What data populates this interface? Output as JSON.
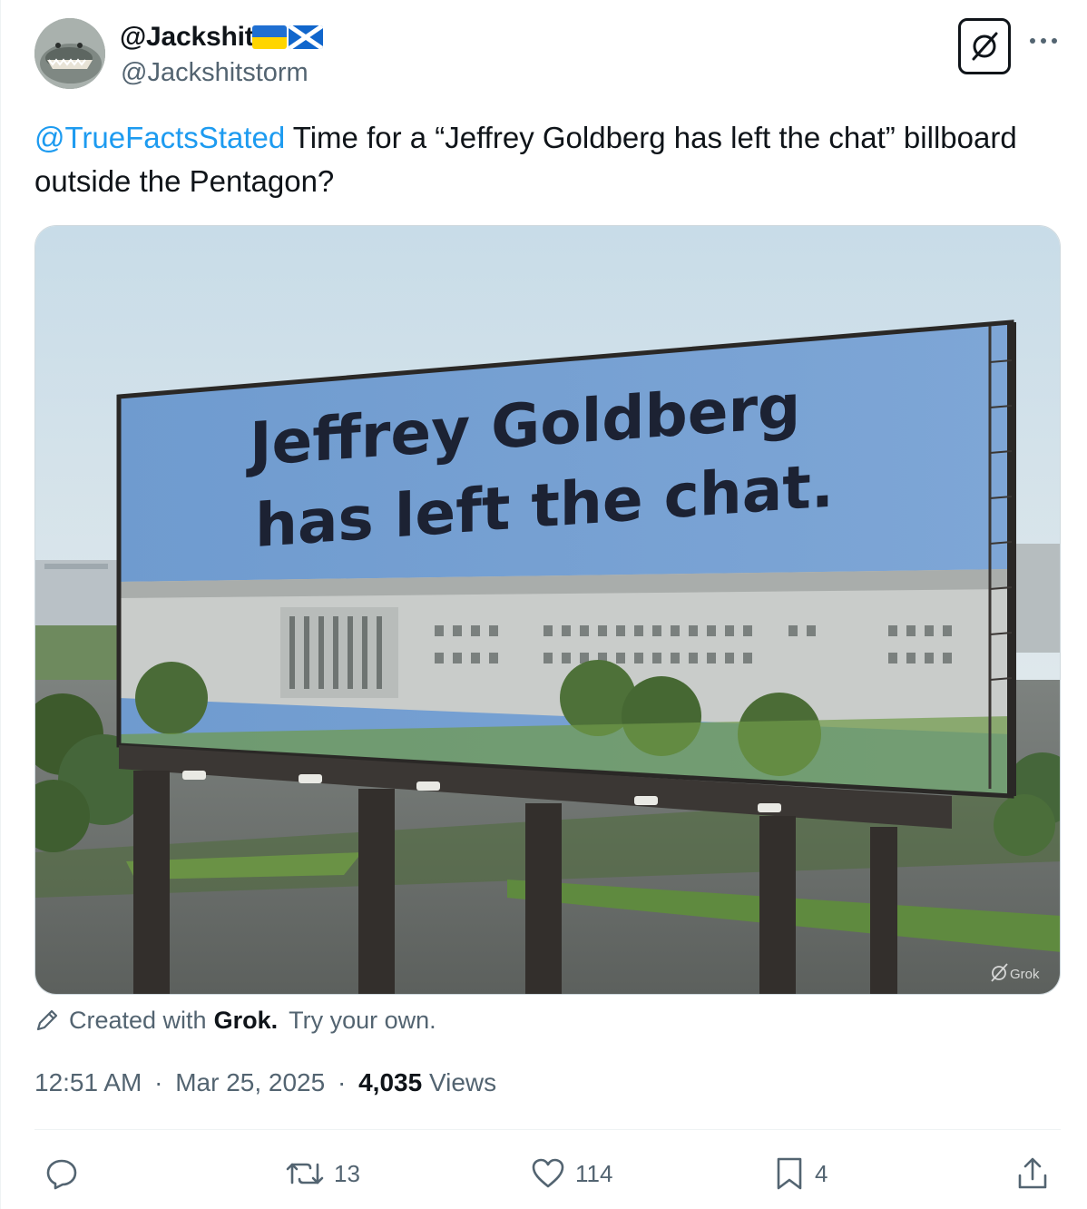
{
  "author": {
    "display_name": "@Jackshit",
    "handle": "@Jackshitstorm",
    "flags": [
      "ukraine-flag",
      "scotland-flag"
    ]
  },
  "header_actions": {
    "grok_icon": "grok-slash-circle-icon",
    "more_icon": "more-dots-icon"
  },
  "tweet": {
    "mention": "@TrueFactsStated",
    "text": " Time for a “Jeffrey Goldberg has left the chat” billboard outside the Pentagon?"
  },
  "media": {
    "billboard_line1": "Jeffrey Goldberg",
    "billboard_line2": "has left the chat.",
    "watermark": "Grok"
  },
  "created_with": {
    "prefix": "Created with",
    "brand": "Grok",
    "suffix": ".",
    "link": "Try your own."
  },
  "meta": {
    "time": "12:51 AM",
    "date": "Mar 25, 2025",
    "views_count": "4,035",
    "views_label": "Views"
  },
  "actions": {
    "reply_count": "",
    "retweet_count": "13",
    "like_count": "114",
    "bookmark_count": "4"
  },
  "colors": {
    "accent": "#1d9bf0",
    "text": "#0f1419",
    "secondary": "#536471"
  }
}
